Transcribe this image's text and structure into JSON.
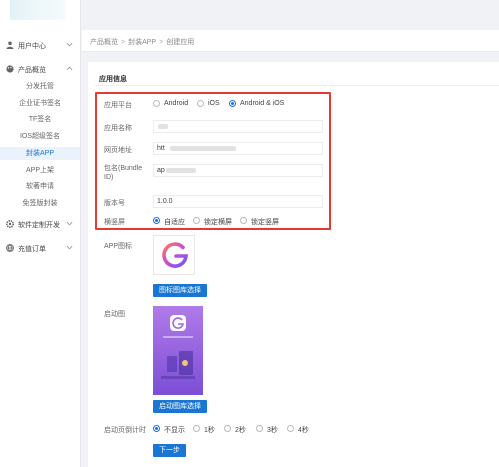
{
  "sidebar": {
    "groups": [
      {
        "label": "用户中心",
        "icon": "user-icon"
      },
      {
        "label": "产品概览",
        "icon": "palette-icon"
      },
      {
        "label": "软件定制开发",
        "icon": "gear-icon"
      },
      {
        "label": "充值订单",
        "icon": "globe-icon"
      }
    ],
    "items": [
      "分发托管",
      "企业证书签名",
      "TF签名",
      "IOS超级签名",
      "封装APP",
      "APP上架",
      "软著申请",
      "免签版封装"
    ]
  },
  "breadcrumb": [
    "产品概览",
    "封装APP",
    "创建应用"
  ],
  "section_title": "应用信息",
  "form": {
    "platform_label": "应用平台",
    "platform_options": [
      "Android",
      "iOS",
      "Android & iOS"
    ],
    "app_name_label": "应用名称",
    "url_label": "网页地址",
    "url_value": "htt",
    "bundle_label_1": "包名(Bundle",
    "bundle_label_2": "ID)",
    "bundle_value": "ap",
    "version_label": "版本号",
    "version_value": "1.0.0",
    "orientation_label": "横竖屏",
    "orientation_options": [
      "自适应",
      "锁定横屏",
      "锁定竖屏"
    ],
    "app_icon_label": "APP图标",
    "icon_button": "图标图库选择",
    "splash_label": "启动图",
    "splash_button": "启动图库选择",
    "countdown_label": "启动页倒计时",
    "countdown_options": [
      "不显示",
      "1秒",
      "2秒",
      "3秒",
      "4秒"
    ],
    "next_button": "下一步"
  },
  "colors": {
    "accent": "#1976d2",
    "highlight_border": "#e53935",
    "active_bg": "#eaf2fb"
  }
}
